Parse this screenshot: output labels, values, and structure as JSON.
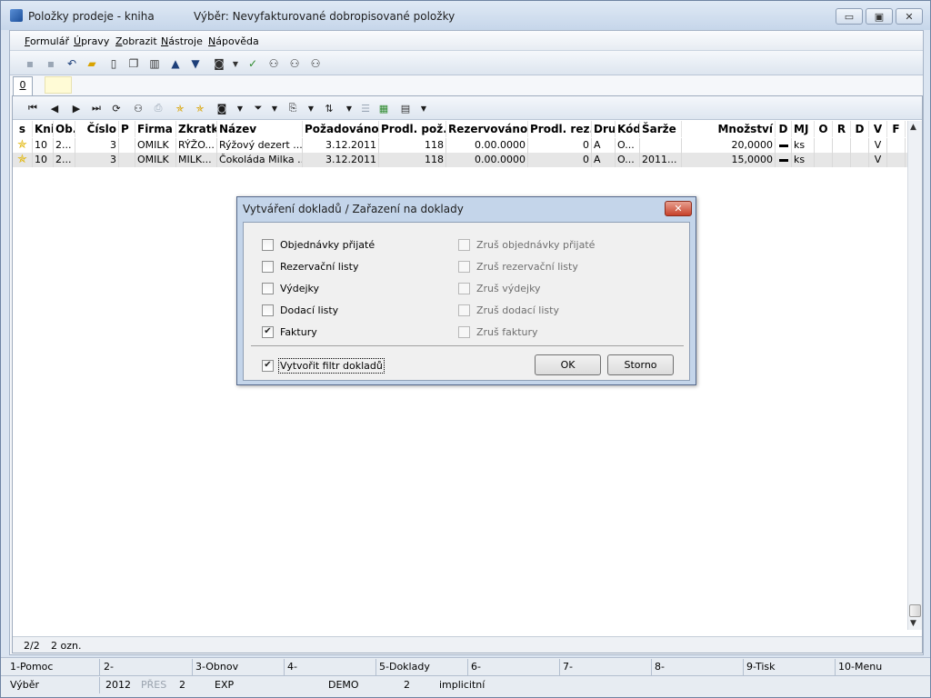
{
  "window": {
    "title": "Položky prodeje - kniha",
    "selection_title": "Výběr: Nevyfakturované dobropisované položky",
    "min_label": "▭",
    "max_label": "▣",
    "close_label": "✕"
  },
  "menu": [
    "Formulář",
    "Úpravy",
    "Zobrazit",
    "Nástroje",
    "Nápověda"
  ],
  "tabs": {
    "active": "0"
  },
  "table": {
    "headers": [
      "s",
      "Kni",
      "Ob.",
      "Číslo",
      "P",
      "Firma",
      "Zkratka",
      "Název",
      "Požadováno",
      "Prodl. pož.",
      "Rezervováno",
      "Prodl. rez.",
      "Dru",
      "Kód",
      "Šarže",
      "Množství",
      "D",
      "MJ",
      "O",
      "R",
      "D",
      "V",
      "F"
    ],
    "rows": [
      {
        "kni": "10",
        "ob": "2...",
        "cislo": "3",
        "firma": "OMILK",
        "zkratka": "RÝŽO...",
        "nazev": "Rýžový dezert ...",
        "pozadovano": "3.12.2011",
        "prodl_poz": "118",
        "rezervovano": "0.00.0000",
        "prodl_rez": "0",
        "dru": "A",
        "kod": "O...",
        "sarze": "",
        "mnozstvi": "20,0000",
        "mj": "ks",
        "v": "V"
      },
      {
        "kni": "10",
        "ob": "2...",
        "cislo": "3",
        "firma": "OMILK",
        "zkratka": "MILK...",
        "nazev": "Čokoláda Milka ...",
        "pozadovano": "3.12.2011",
        "prodl_poz": "118",
        "rezervovano": "0.00.0000",
        "prodl_rez": "0",
        "dru": "A",
        "kod": "O...",
        "sarze": "2011...",
        "mnozstvi": "15,0000",
        "mj": "ks",
        "v": "V"
      }
    ]
  },
  "grid_status": {
    "position": "2/2",
    "marked": "2 ozn."
  },
  "function_keys": [
    "1-Pomoc",
    "2-",
    "3-Obnov",
    "4-",
    "5-Doklady",
    "6-",
    "7-",
    "8-",
    "9-Tisk",
    "10-Menu"
  ],
  "status_bar": {
    "mode": "Výběr",
    "year": "2012",
    "pres": "PŘES",
    "num1": "2",
    "exp": "EXP",
    "demo": "DEMO",
    "num2": "2",
    "implicit": "implicitní"
  },
  "dialog": {
    "title": "Vytváření dokladů / Zařazení na doklady",
    "left_options": [
      {
        "label": "Objednávky přijaté",
        "checked": false
      },
      {
        "label": "Rezervační listy",
        "checked": false
      },
      {
        "label": "Výdejky",
        "checked": false
      },
      {
        "label": "Dodací listy",
        "checked": false
      },
      {
        "label": "Faktury",
        "checked": true
      }
    ],
    "right_options": [
      {
        "label": "Zruš objednávky přijaté",
        "checked": false
      },
      {
        "label": "Zruš rezervační listy",
        "checked": false
      },
      {
        "label": "Zruš výdejky",
        "checked": false
      },
      {
        "label": "Zruš dodací listy",
        "checked": false
      },
      {
        "label": "Zruš faktury",
        "checked": false
      }
    ],
    "filter": {
      "label": "Vytvořit filtr dokladů",
      "checked": true
    },
    "ok_label": "OK",
    "cancel_label": "Storno",
    "check_mark": "✔",
    "close_label": "✕"
  },
  "colors": {
    "title_bg": "#c6d6ea",
    "dialog_frame": "#c4d5ea",
    "close_red": "#c7412a",
    "star": "#e1b400"
  },
  "icons": [
    "app-icon",
    "save-icon",
    "undo-icon",
    "open-folder-icon",
    "new-doc-icon",
    "arrow-up-icon",
    "arrow-down-icon",
    "binoculars-icon",
    "filter-icon",
    "sort-icon",
    "star-icon"
  ]
}
